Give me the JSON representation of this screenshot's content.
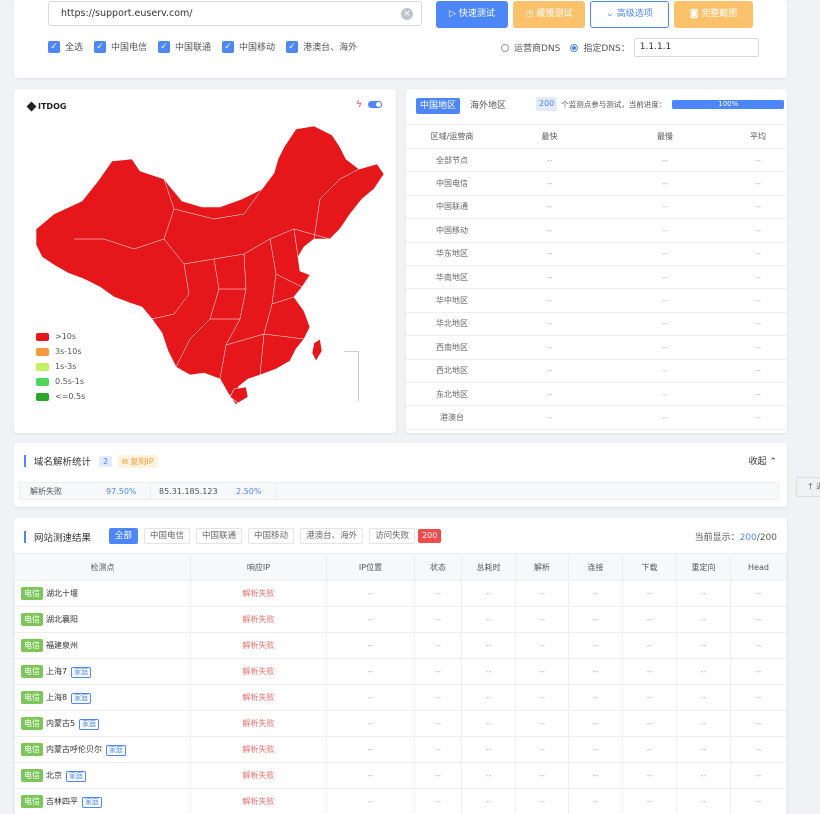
{
  "top": {
    "url": "https://support.euserv.com/",
    "buttons": {
      "quick": "▷ 快速测试",
      "slow": "◷ 缓慢测试",
      "advanced": "⌄ 高级选项",
      "screenshot": "◙ 完整截图"
    },
    "checkboxes": [
      "全选",
      "中国电信",
      "中国联通",
      "中国移动",
      "港澳台、海外"
    ],
    "dns": {
      "isp_label": "运营商DNS",
      "custom_label": "指定DNS：",
      "custom_value": "1.1.1.1"
    }
  },
  "map": {
    "logo": "ITDOG",
    "legend": [
      {
        "label": ">10s",
        "color": "#e5171a"
      },
      {
        "label": "3s-10s",
        "color": "#f39a3b"
      },
      {
        "label": "1s-3s",
        "color": "#c0f064"
      },
      {
        "label": "0.5s-1s",
        "color": "#4dd65a"
      },
      {
        "label": "<=0.5s",
        "color": "#2aa62c"
      }
    ],
    "fill_color": "#e5171a"
  },
  "stats": {
    "tabs": [
      "中国地区",
      "海外地区"
    ],
    "probe_count": "200",
    "probe_text": "个监测点参与测试，当前进度：",
    "progress": "100%",
    "headers": [
      "区域/运营商",
      "最快",
      "最慢",
      "平均"
    ],
    "rows": [
      "全部节点",
      "中国电信",
      "中国联通",
      "中国移动",
      "华东地区",
      "华南地区",
      "华中地区",
      "华北地区",
      "西南地区",
      "西北地区",
      "东北地区",
      "港澳台"
    ],
    "dash": "--"
  },
  "dns_stats": {
    "title": "域名解析统计",
    "count": "2",
    "copy_ip": "⧉ 复制IP",
    "collapse": "收起 ⌃",
    "items": [
      {
        "label": "解析失败",
        "value": "97.50%"
      },
      {
        "label": "85.31.185.123",
        "value": "2.50%"
      }
    ]
  },
  "side_button": "↑ 返",
  "results": {
    "title": "网站测速结果",
    "filters": [
      "全部",
      "中国电信",
      "中国联通",
      "中国移动",
      "港澳台、海外",
      "访问失败"
    ],
    "fail_count": "200",
    "current_label": "当前显示：",
    "current_value": "200",
    "current_total": "/200",
    "headers": [
      "检测点",
      "响应IP",
      "IP位置",
      "状态",
      "总耗时",
      "解析",
      "连接",
      "下载",
      "重定向",
      "Head"
    ],
    "rows": [
      {
        "isp": "电信",
        "name": "湖北十堰",
        "home": "",
        "ip": "解析失败"
      },
      {
        "isp": "电信",
        "name": "湖北襄阳",
        "home": "",
        "ip": "解析失败"
      },
      {
        "isp": "电信",
        "name": "福建泉州",
        "home": "",
        "ip": "解析失败"
      },
      {
        "isp": "电信",
        "name": "上海7",
        "home": "家庭",
        "ip": "解析失败"
      },
      {
        "isp": "电信",
        "name": "上海8",
        "home": "家庭",
        "ip": "解析失败"
      },
      {
        "isp": "电信",
        "name": "内蒙古5",
        "home": "家庭",
        "ip": "解析失败"
      },
      {
        "isp": "电信",
        "name": "内蒙古呼伦贝尔",
        "home": "家庭",
        "ip": "解析失败"
      },
      {
        "isp": "电信",
        "name": "北京",
        "home": "家庭",
        "ip": "解析失败"
      },
      {
        "isp": "电信",
        "name": "吉林四平",
        "home": "家庭",
        "ip": "解析失败"
      }
    ],
    "dash": "--"
  }
}
